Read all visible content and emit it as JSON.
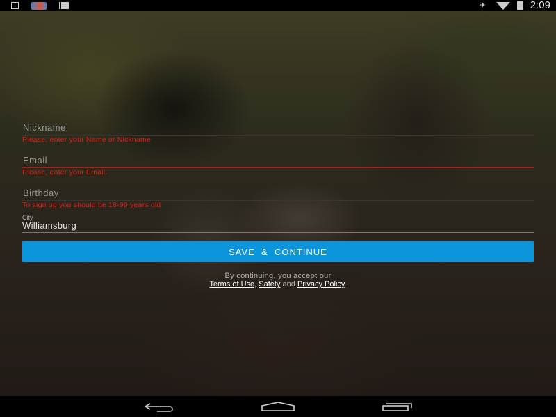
{
  "status_bar": {
    "time": "2:09",
    "icons": [
      "download-icon",
      "app-icon",
      "barcode-icon",
      "mute-icon",
      "wifi-icon",
      "battery-charging-icon"
    ]
  },
  "form": {
    "nickname": {
      "label": "Nickname",
      "error": "Please, enter your Name or Nickname"
    },
    "email": {
      "label": "Email",
      "error": "Please, enter your Email."
    },
    "birthday": {
      "label": "Birthday",
      "error": "To sign up you should be 18-99 years old"
    },
    "city": {
      "label": "City",
      "value": "Williamsburg"
    }
  },
  "save_button": "SAVE  &  CONTINUE",
  "legal": {
    "line1": "By continuing, you accept our",
    "terms": "Terms of Use",
    "comma": ",",
    "safety": "Safety",
    "and": "and",
    "privacy": "Privacy Policy",
    "period": "."
  },
  "nav": [
    "back-icon",
    "home-icon",
    "recent-apps-icon"
  ],
  "colors": {
    "accent": "#0c95da",
    "error": "#e21b16"
  }
}
